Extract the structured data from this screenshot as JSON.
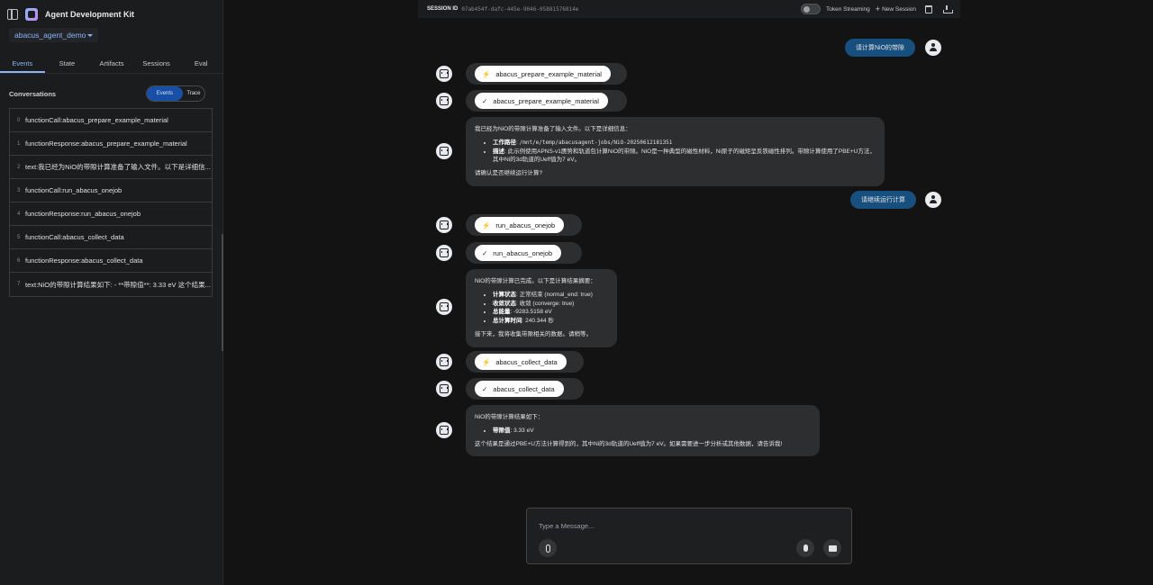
{
  "sidebar": {
    "title": "Agent Development Kit",
    "app_selector": "abacus_agent_demo",
    "tabs": [
      "Events",
      "State",
      "Artifacts",
      "Sessions",
      "Eval"
    ],
    "conversations_label": "Conversations",
    "view_toggle": {
      "events": "Events",
      "trace": "Trace"
    },
    "events": [
      {
        "index": "0",
        "text": "functionCall:abacus_prepare_example_material"
      },
      {
        "index": "1",
        "text": "functionResponse:abacus_prepare_example_material"
      },
      {
        "index": "2",
        "text": "text:我已经为NiO的带隙计算准备了输入文件。以下是详细信..."
      },
      {
        "index": "3",
        "text": "functionCall:run_abacus_onejob"
      },
      {
        "index": "4",
        "text": "functionResponse:run_abacus_onejob"
      },
      {
        "index": "5",
        "text": "functionCall:abacus_collect_data"
      },
      {
        "index": "6",
        "text": "functionResponse:abacus_collect_data"
      },
      {
        "index": "7",
        "text": "text:NiO的带隙计算结果如下: - **带隙值**: 3.33 eV 这个结果..."
      }
    ]
  },
  "topbar": {
    "session_label": "SESSION ID",
    "session_id": "07ab454f-dafc-445e-9046-05881576814e",
    "token_streaming": "Token Streaming",
    "new_session": "New Session"
  },
  "chat": {
    "user_msg_1": "请计算NiO的带隙",
    "fn_1": "abacus_prepare_example_material",
    "fn_2": "abacus_prepare_example_material",
    "bot_1": {
      "intro": "我已经为NiO的带隙计算准备了输入文件。以下是详细信息：",
      "item1_label": "工作路径",
      "item1_value": "/mnt/e/temp/abacusagent-jobs/NiO-20250612181351",
      "item2_label": "描述",
      "item2_value": "此示例使用APNS-v1赝势和轨道包计算NiO的带隙。NiO是一种典型的磁性材料，Ni原子的磁矩呈反铁磁性排列。带隙计算使用了PBE+U方法，其中Ni的3d轨道的Ueff值为7 eV。",
      "outro": "请确认是否继续运行计算?"
    },
    "user_msg_2": "请继续运行计算",
    "fn_3": "run_abacus_onejob",
    "fn_4": "run_abacus_onejob",
    "bot_2": {
      "intro": "NiO的带隙计算已完成。以下是计算结果摘要：",
      "item1_label": "计算状态",
      "item1_value": "正常结束 (normal_end: true)",
      "item2_label": "收敛状态",
      "item2_value": "收敛 (converge: true)",
      "item3_label": "总能量",
      "item3_value": "-9283.5158 eV",
      "item4_label": "总计算时间",
      "item4_value": "240.344 秒",
      "outro": "接下来，我将收集带隙相关的数据。请稍等。"
    },
    "fn_5": "abacus_collect_data",
    "fn_6": "abacus_collect_data",
    "bot_3": {
      "intro": "NiO的带隙计算结果如下：",
      "item1_label": "带隙值",
      "item1_value": "3.33 eV",
      "outro": "这个结果是通过PBE+U方法计算得到的，其中Ni的3d轨道的Ueff值为7 eV。如果需要进一步分析或其他数据，请告诉我!"
    }
  },
  "composer": {
    "placeholder": "Type a Message..."
  }
}
